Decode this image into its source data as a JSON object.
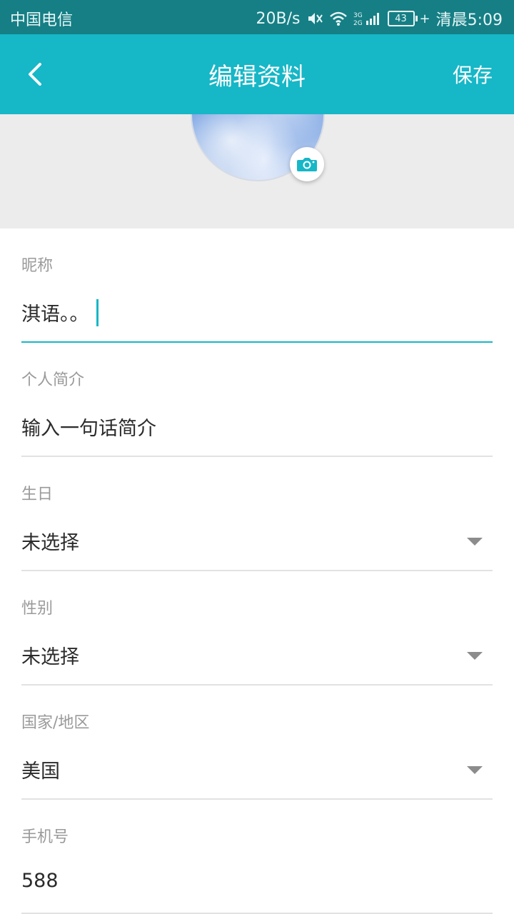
{
  "status_bar": {
    "carrier": "中国电信",
    "net_speed": "20B/s",
    "battery": "43",
    "time": "清晨5:09",
    "icons": [
      "mute-icon",
      "wifi-icon",
      "signal-icon",
      "battery-icon"
    ]
  },
  "header": {
    "title": "编辑资料",
    "save_label": "保存",
    "back_icon": "back-arrow-icon"
  },
  "avatar": {
    "camera_icon": "camera-icon"
  },
  "fields": {
    "nickname": {
      "label": "昵称",
      "value": "淇语。。"
    },
    "bio": {
      "label": "个人简介",
      "value": "输入一句话简介"
    },
    "birthday": {
      "label": "生日",
      "value": "未选择"
    },
    "gender": {
      "label": "性别",
      "value": "未选择"
    },
    "region": {
      "label": "国家/地区",
      "value": "美国"
    },
    "phone": {
      "label": "手机号",
      "value": "588"
    }
  },
  "colors": {
    "status_bar": "#157f85",
    "accent": "#16b7c7",
    "header_bg": "#16b7c7",
    "avatar_area": "#ececec",
    "label": "#9a9a9a",
    "value": "#2b2b2b",
    "divider": "#e2e2e2"
  }
}
